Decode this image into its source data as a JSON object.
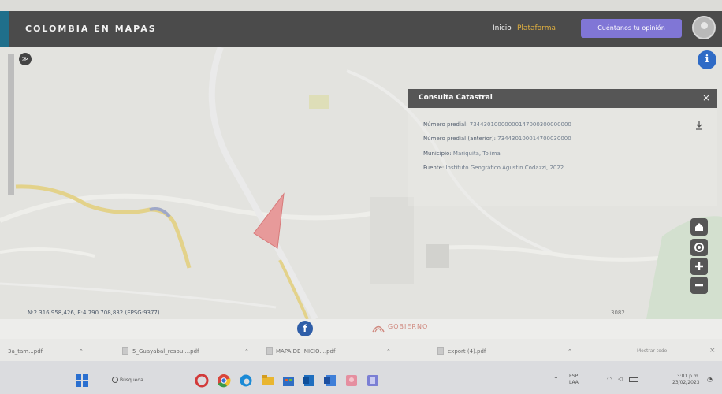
{
  "header": {
    "brand": "COLOMBIA EN MAPAS",
    "nav_inicio": "Inicio",
    "nav_plataforma": "Plataforma",
    "opinion_button": "Cuéntanos tu opinión"
  },
  "map": {
    "layers_toggle": "≫",
    "info_button": "i",
    "coordinates": "N:2.316.958,426, E:4.790.708,832 (EPSG:9377)",
    "scale": "3082"
  },
  "panel": {
    "title": "Consulta Catastral",
    "close": "×",
    "rows": [
      {
        "label": "Número predial:",
        "value": "73443010000000147000300000000"
      },
      {
        "label": "Número predial (anterior):",
        "value": "734430100014700030000"
      },
      {
        "label": "Municipio:",
        "value": "Mariquita, Tolima"
      },
      {
        "label": "Fuente:",
        "value": "Instituto Geográfico Agustín Codazzi, 2022"
      }
    ]
  },
  "footer": {
    "facebook": "f",
    "gov_text": "GOBIERNO"
  },
  "downloads": {
    "items": [
      "3a_tam...pdf",
      "5_Guayabal_respu....pdf",
      "MAPA DE INICIO....pdf",
      "export (4).pdf"
    ],
    "show_all": "Mostrar todo",
    "close": "×"
  },
  "taskbar": {
    "search": "Búsqueda",
    "lang_line1": "ESP",
    "lang_line2": "LAA",
    "time": "3:01 p.m.",
    "date": "23/02/2023"
  },
  "colors": {
    "header": "#4b4b4b",
    "accent_button": "#8076d6",
    "info_blue": "#2f6bc6",
    "parcel": "#e79a9a"
  }
}
